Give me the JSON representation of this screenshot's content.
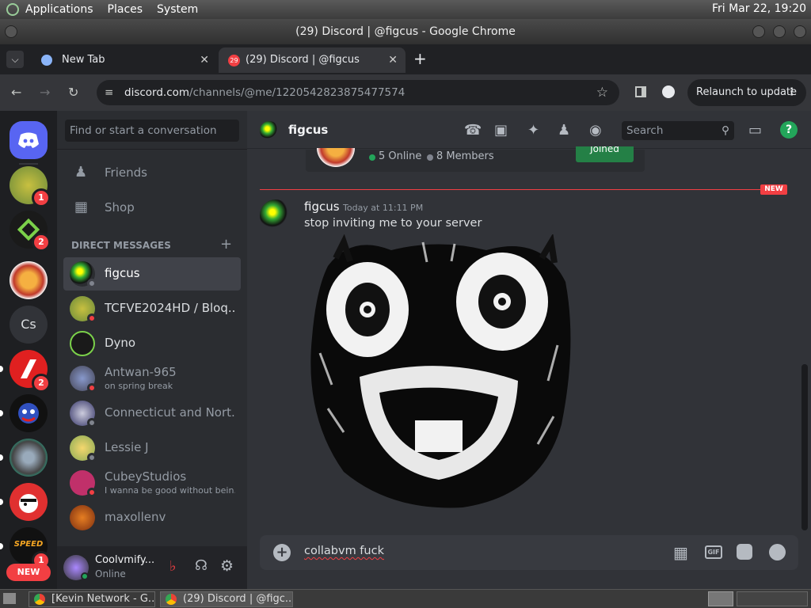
{
  "top_panel": {
    "menus": [
      "Applications",
      "Places",
      "System"
    ],
    "clock": "Fri Mar 22, 19:20"
  },
  "window": {
    "title": "(29) Discord | @figcus - Google Chrome"
  },
  "tabs": [
    {
      "label": "New Tab"
    },
    {
      "label": "(29) Discord | @figcus",
      "badge": "29"
    }
  ],
  "address": {
    "host": "discord.com",
    "path": "/channels/@me/1220542823875477574"
  },
  "relaunch_label": "Relaunch to update",
  "guilds": {
    "text_server": "Cs",
    "badges": [
      "1",
      "2",
      "2",
      "1"
    ],
    "new_label": "NEW"
  },
  "dm_panel": {
    "search_placeholder": "Find or start a conversation",
    "friends": "Friends",
    "shop": "Shop",
    "section_title": "DIRECT MESSAGES",
    "dms": [
      {
        "name": "figcus",
        "subtitle": ""
      },
      {
        "name": "TCFVE2024HD / Bloq...",
        "subtitle": ""
      },
      {
        "name": "Dyno",
        "subtitle": ""
      },
      {
        "name": "Antwan-965",
        "subtitle": "on spring break"
      },
      {
        "name": "Connecticut and Nort...",
        "subtitle": ""
      },
      {
        "name": "Lessie J",
        "subtitle": ""
      },
      {
        "name": "CubeyStudios",
        "subtitle": "I wanna be good without bein..."
      },
      {
        "name": "maxollenv",
        "subtitle": ""
      }
    ]
  },
  "user": {
    "name": "Coolvmify...",
    "status": "Online"
  },
  "chat": {
    "channel_name": "figcus",
    "search_placeholder": "Search",
    "invite": {
      "online": "5 Online",
      "members": "8 Members",
      "button": "Joined"
    },
    "new_marker": "NEW",
    "message": {
      "author": "figcus",
      "timestamp": "Today at 11:11 PM",
      "text": "stop inviting me to your server"
    },
    "composer_text": "collabvm fuck",
    "gif_label": "GIF"
  },
  "taskbar": {
    "items": [
      "[Kevin Network - G...",
      "(29) Discord | @figc..."
    ]
  },
  "colors": {
    "blurple": "#5865f2",
    "danger": "#f23f43",
    "online": "#23a55a",
    "bg_primary": "#313338",
    "bg_secondary": "#2b2d31",
    "bg_tertiary": "#1e1f22"
  }
}
